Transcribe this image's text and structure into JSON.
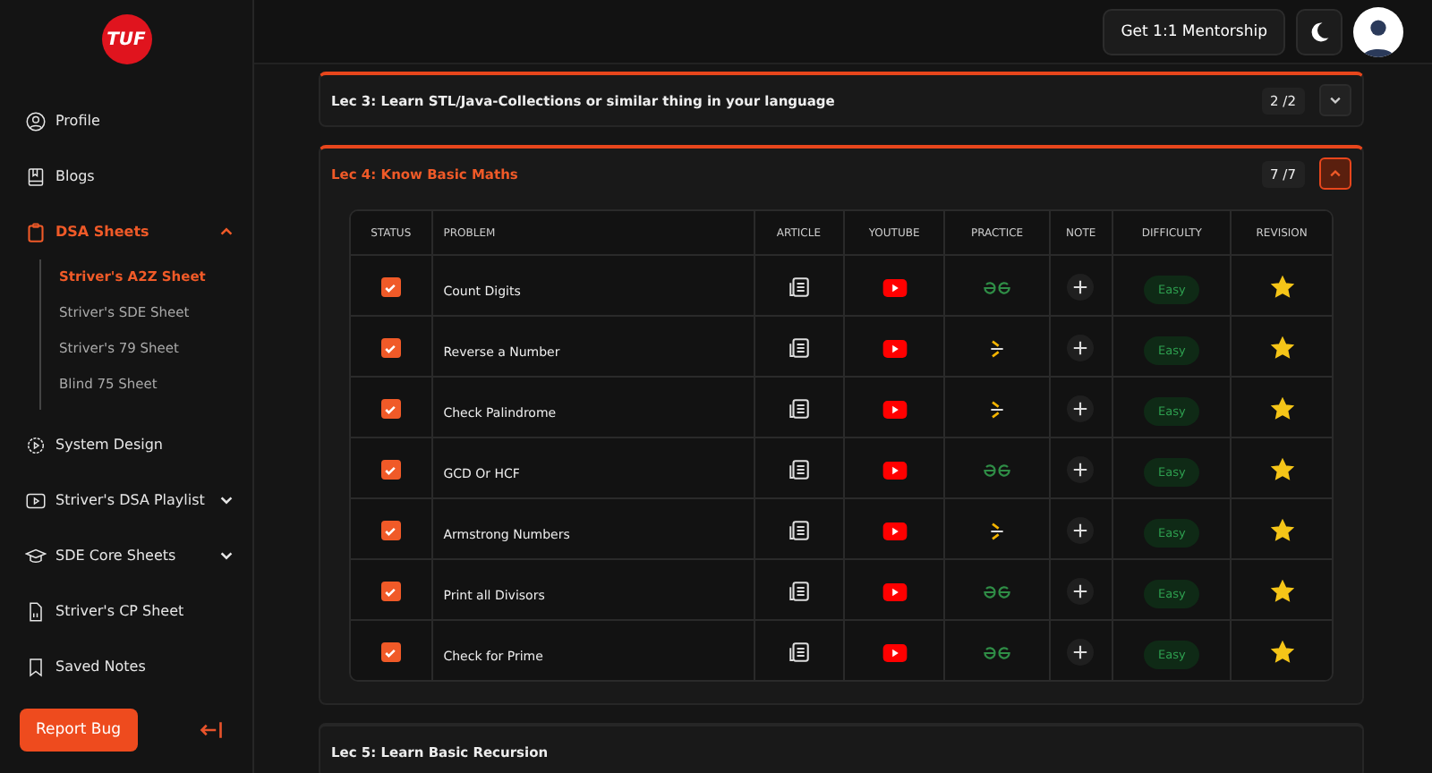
{
  "sidebar": {
    "logo": "TUF",
    "items": [
      {
        "label": "Profile",
        "selected": false
      },
      {
        "label": "Blogs",
        "selected": false
      },
      {
        "label": "DSA Sheets",
        "selected": true,
        "expanded": true,
        "children": [
          {
            "label": "Striver's A2Z Sheet",
            "selected": true
          },
          {
            "label": "Striver's SDE Sheet",
            "selected": false
          },
          {
            "label": "Striver's 79 Sheet",
            "selected": false
          },
          {
            "label": "Blind 75 Sheet",
            "selected": false
          }
        ]
      },
      {
        "label": "System Design",
        "selected": false
      },
      {
        "label": "Striver's DSA Playlist",
        "selected": false,
        "expanded": false
      },
      {
        "label": "SDE Core Sheets",
        "selected": false,
        "expanded": false
      },
      {
        "label": "Striver's CP Sheet",
        "selected": false
      },
      {
        "label": "Saved Notes",
        "selected": false
      }
    ],
    "report_button": "Report Bug"
  },
  "header": {
    "mentorship_button": "Get 1:1 Mentorship"
  },
  "lectures": [
    {
      "title": "Lec 3: Learn STL/Java-Collections or similar thing in your language",
      "count": "2 /2",
      "expanded": false
    },
    {
      "title": "Lec 4: Know Basic Maths",
      "count": "7 /7",
      "expanded": true,
      "columns": [
        "STATUS",
        "PROBLEM",
        "ARTICLE",
        "YOUTUBE",
        "PRACTICE",
        "NOTE",
        "DIFFICULTY",
        "REVISION"
      ],
      "rows": [
        {
          "checked": true,
          "problem": "Count Digits",
          "kind": "gfg",
          "difficulty": "Easy",
          "starred": true
        },
        {
          "checked": true,
          "problem": "Reverse a Number",
          "kind": "codestudio",
          "difficulty": "Easy",
          "starred": true
        },
        {
          "checked": true,
          "problem": "Check Palindrome",
          "kind": "codestudio",
          "difficulty": "Easy",
          "starred": true
        },
        {
          "checked": true,
          "problem": "GCD Or HCF",
          "kind": "gfg",
          "difficulty": "Easy",
          "starred": true
        },
        {
          "checked": true,
          "problem": "Armstrong Numbers",
          "kind": "codestudio",
          "difficulty": "Easy",
          "starred": true
        },
        {
          "checked": true,
          "problem": "Print all Divisors",
          "kind": "gfg",
          "difficulty": "Easy",
          "starred": true
        },
        {
          "checked": true,
          "problem": "Check for Prime",
          "kind": "gfg",
          "difficulty": "Easy",
          "starred": true
        }
      ]
    },
    {
      "title": "Lec 5: Learn Basic Recursion",
      "expanded": false
    }
  ]
}
